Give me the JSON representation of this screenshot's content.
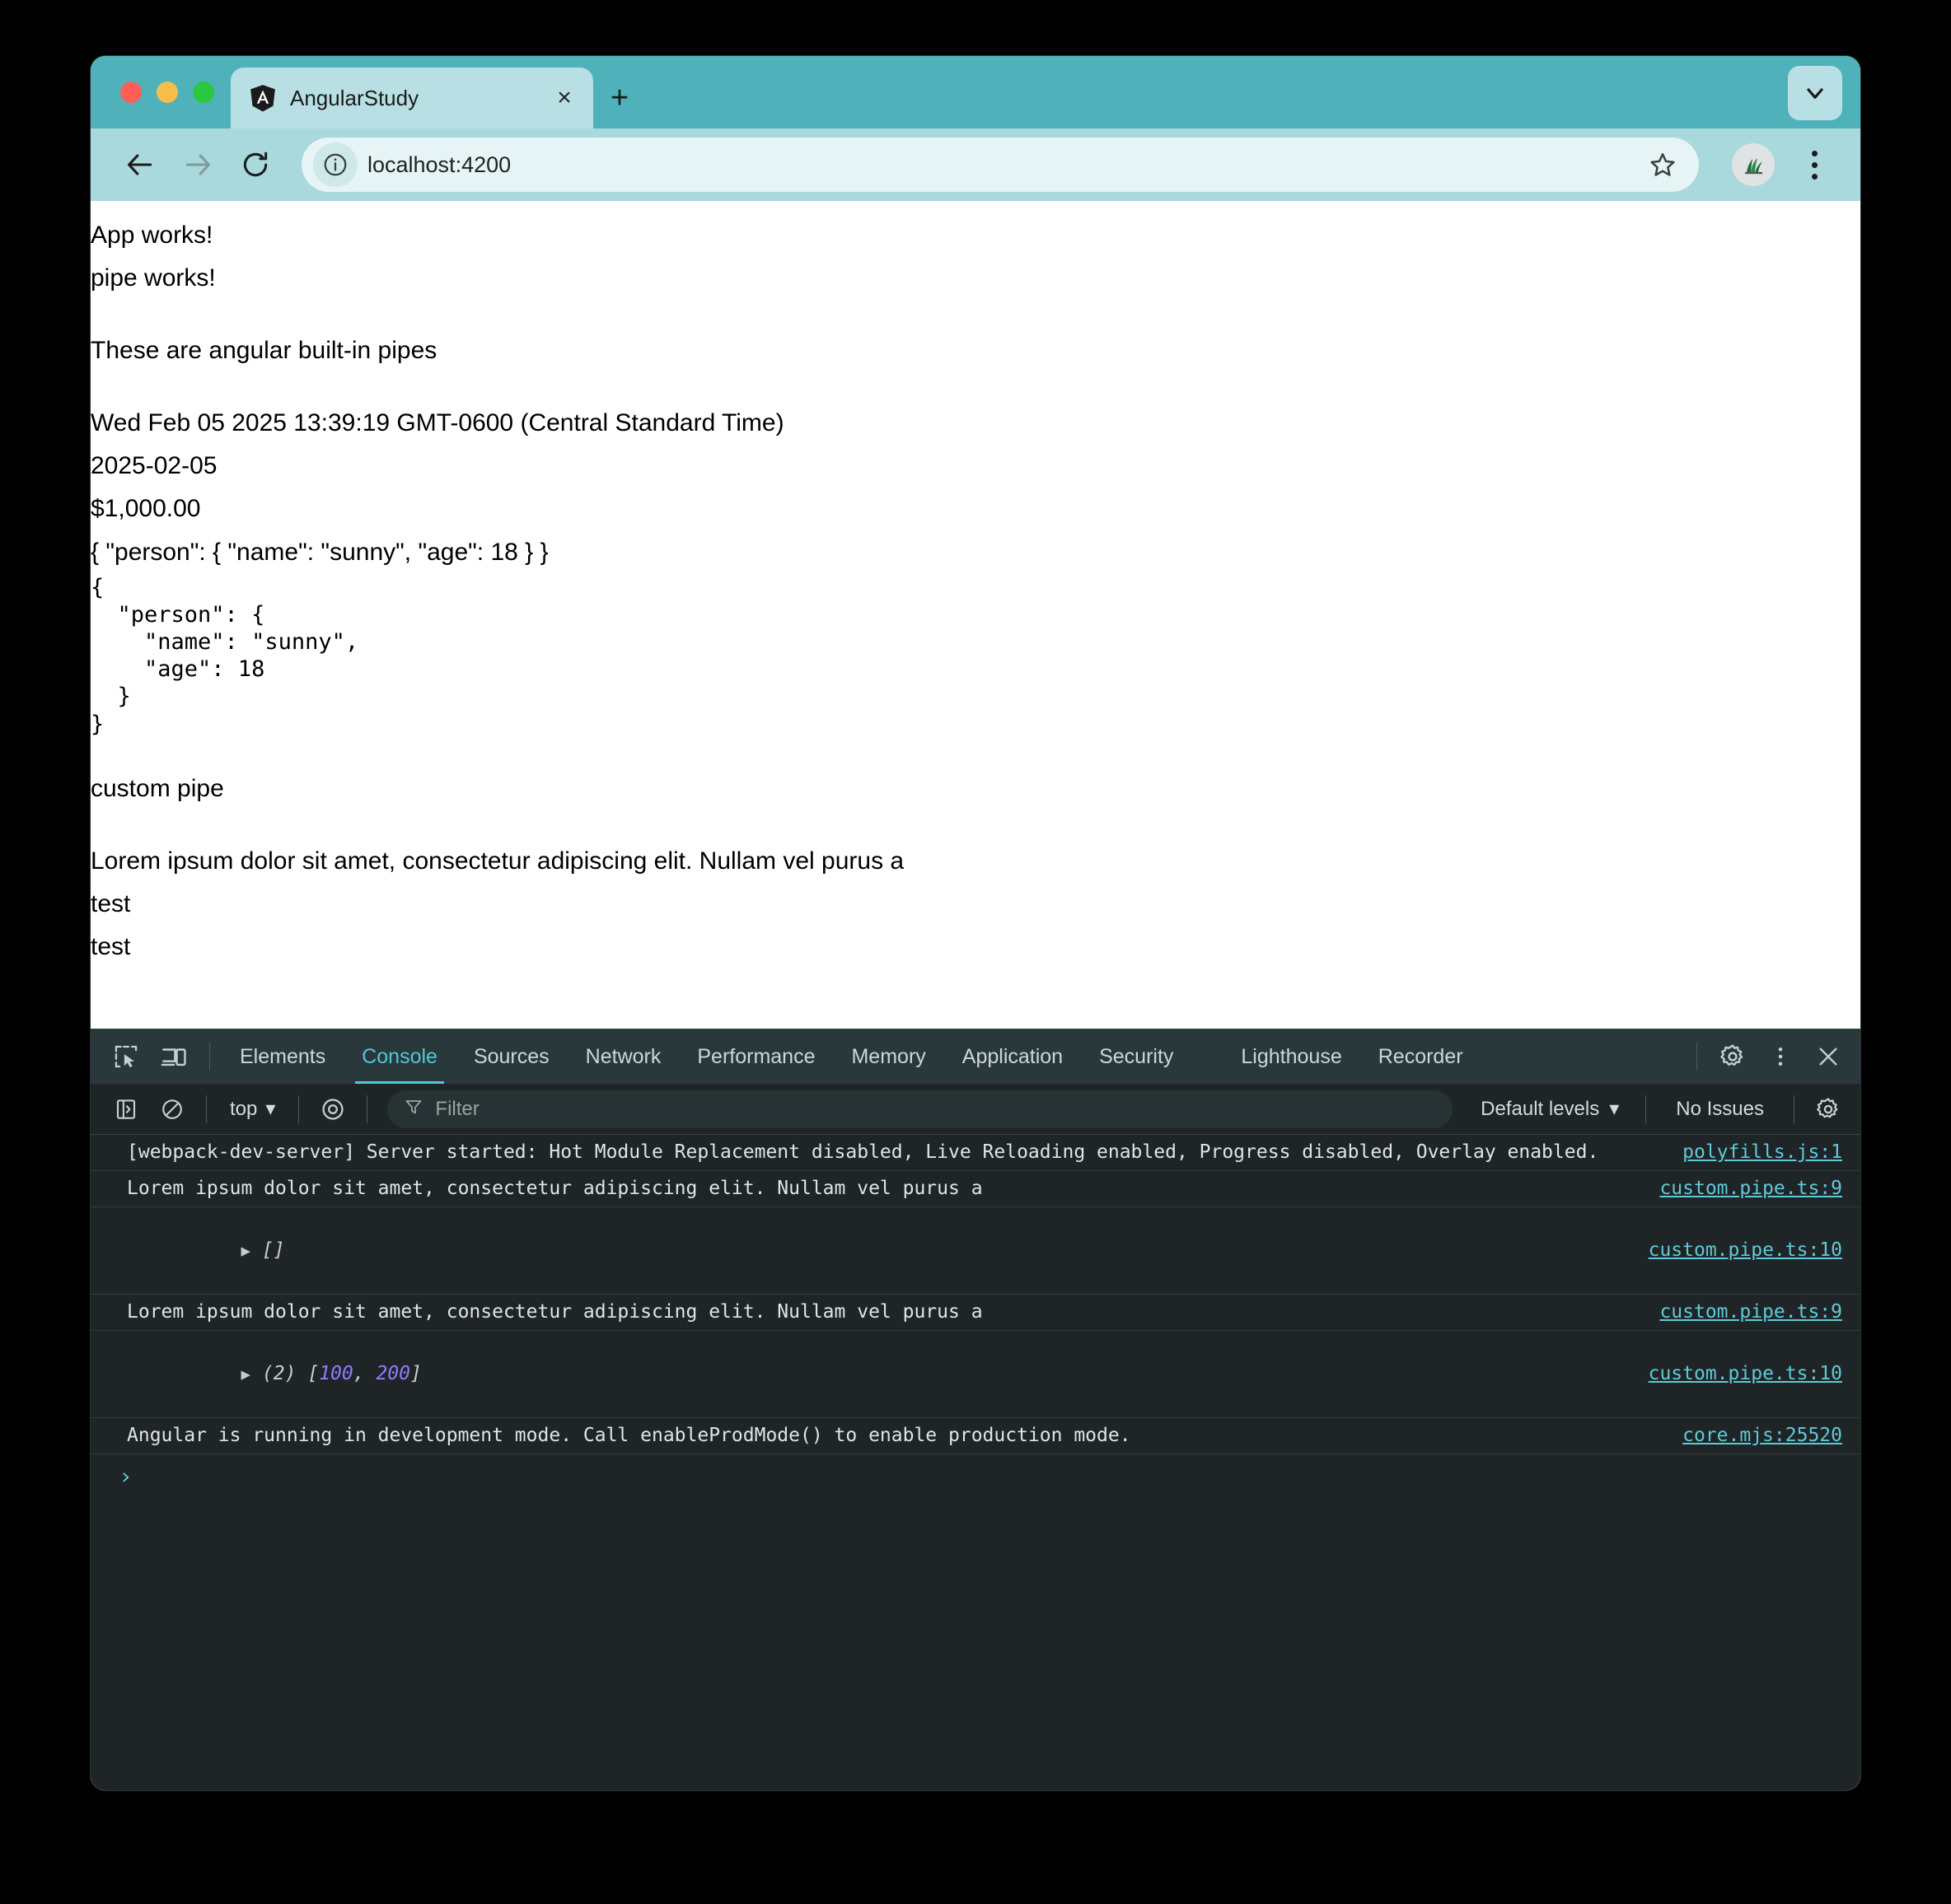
{
  "browser": {
    "tab": {
      "title": "AngularStudy",
      "favicon": "angular-logo-icon",
      "close_label": "×"
    },
    "new_tab_label": "+",
    "tab_list_chevron": "chevron-down-icon",
    "toolbar": {
      "back": "back-arrow-icon",
      "forward": "forward-arrow-icon",
      "reload": "reload-icon",
      "site_info": "info-circle-icon",
      "url_host": "localhost",
      "url_port": ":4200",
      "url_full": "localhost:4200",
      "bookmark": "star-icon",
      "profile": "profile-avatar-plant",
      "menu": "three-dot-menu-icon"
    }
  },
  "page": {
    "lines": [
      "App works!",
      "pipe works!",
      "",
      "These are angular built-in pipes",
      "",
      "Wed Feb 05 2025 13:39:19 GMT-0600 (Central Standard Time)",
      "2025-02-05",
      "$1,000.00",
      "{ \"person\": { \"name\": \"sunny\", \"age\": 18 } }"
    ],
    "json_block": "{\n  \"person\": {\n    \"name\": \"sunny\",\n    \"age\": 18\n  }\n}",
    "after_lines": [
      "",
      "custom pipe",
      "",
      "Lorem ipsum dolor sit amet, consectetur adipiscing elit. Nullam vel purus a",
      "test",
      "test"
    ],
    "l0": "App works!",
    "l1": "pipe works!",
    "l2": "These are angular built-in pipes",
    "l3": "Wed Feb 05 2025 13:39:19 GMT-0600 (Central Standard Time)",
    "l4": "2025-02-05",
    "l5": "$1,000.00",
    "l6": "{ \"person\": { \"name\": \"sunny\", \"age\": 18 } }",
    "l7": "custom pipe",
    "l8": "Lorem ipsum dolor sit amet, consectetur adipiscing elit. Nullam vel purus a",
    "l9": "test",
    "l10": "test"
  },
  "devtools": {
    "tabs": [
      {
        "label": "Elements",
        "active": false
      },
      {
        "label": "Console",
        "active": true
      },
      {
        "label": "Sources",
        "active": false
      },
      {
        "label": "Network",
        "active": false
      },
      {
        "label": "Performance",
        "active": false
      },
      {
        "label": "Memory",
        "active": false
      },
      {
        "label": "Application",
        "active": false
      },
      {
        "label": "Security",
        "active": false
      },
      {
        "label": "Lighthouse",
        "active": false
      },
      {
        "label": "Recorder",
        "active": false
      }
    ],
    "tab_labels": {
      "elements": "Elements",
      "console": "Console",
      "sources": "Sources",
      "network": "Network",
      "performance": "Performance",
      "memory": "Memory",
      "application": "Application",
      "security": "Security",
      "lighthouse": "Lighthouse",
      "recorder": "Recorder"
    },
    "icons": {
      "inspect": "inspect-element-icon",
      "device": "device-toolbar-icon",
      "settings": "gear-icon",
      "more": "three-dot-menu-icon",
      "close": "close-icon",
      "sidebar": "console-sidebar-icon",
      "clear": "clear-console-icon",
      "eye": "live-expression-eye-icon",
      "filter": "filter-funnel-icon"
    },
    "console_toolbar": {
      "context": "top",
      "context_chevron": "▾",
      "filter_placeholder": "Filter",
      "levels": "Default levels",
      "levels_chevron": "▾",
      "issues": "No Issues"
    },
    "messages": [
      {
        "text": "[webpack-dev-server] Server started: Hot Module Replacement disabled, Live Reloading enabled, Progress disabled, Overlay enabled.",
        "source": "polyfills.js:1",
        "expandable": false
      },
      {
        "text": "Lorem ipsum dolor sit amet, consectetur adipiscing elit. Nullam vel purus a",
        "source": "custom.pipe.ts:9",
        "expandable": false
      },
      {
        "text": "[]",
        "source": "custom.pipe.ts:10",
        "expandable": true,
        "prefix": "",
        "values": []
      },
      {
        "text": "Lorem ipsum dolor sit amet, consectetur adipiscing elit. Nullam vel purus a",
        "source": "custom.pipe.ts:9",
        "expandable": false
      },
      {
        "text": "(2) [100, 200]",
        "source": "custom.pipe.ts:10",
        "expandable": true,
        "prefix": "(2)",
        "values": [
          100,
          200
        ]
      },
      {
        "text": "Angular is running in development mode. Call enableProdMode() to enable production mode.",
        "source": "core.mjs:25520",
        "expandable": false
      }
    ],
    "msg0_text": "[webpack-dev-server] Server started: Hot Module Replacement disabled, Live Reloading enabled, Progress disabled, Overlay enabled.",
    "msg0_src": "polyfills.js:1",
    "msg1_text": "Lorem ipsum dolor sit amet, consectetur adipiscing elit. Nullam vel purus a",
    "msg1_src": "custom.pipe.ts:9",
    "msg2_text": "[]",
    "msg2_src": "custom.pipe.ts:10",
    "msg3_text": "Lorem ipsum dolor sit amet, consectetur adipiscing elit. Nullam vel purus a",
    "msg3_src": "custom.pipe.ts:9",
    "msg4_count": "(2)",
    "msg4_v0": "100",
    "msg4_v1": "200",
    "msg4_src": "custom.pipe.ts:10",
    "msg5_text": "Angular is running in development mode. Call enableProdMode() to enable production mode.",
    "msg5_src": "core.mjs:25520",
    "prompt_caret": "›"
  },
  "colors": {
    "tabstrip": "#4fb2bb",
    "toolbar": "#a9d8dd",
    "active_tab": "#b8e0e4",
    "omnibox": "#e6f4f5",
    "devtools_tabbar": "#29393b",
    "devtools_bg": "#1f2526",
    "accent": "#52c6d6",
    "link": "#5fc9d8",
    "number_literal": "#8e7bff"
  }
}
